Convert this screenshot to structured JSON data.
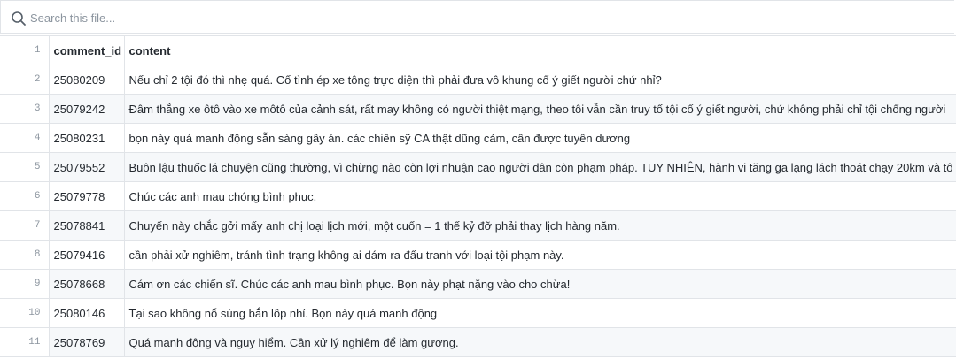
{
  "search": {
    "placeholder": "Search this file..."
  },
  "table": {
    "header_row_number": "1",
    "columns": [
      "comment_id",
      "content"
    ],
    "rows": [
      {
        "n": "2",
        "comment_id": "25080209",
        "content": "Nếu chỉ 2 tội đó thì nhẹ quá. Cố tình ép xe tông trực diện thì phải đưa vô khung cố ý giết người chứ nhỉ?"
      },
      {
        "n": "3",
        "comment_id": "25079242",
        "content": "Đâm thẳng xe ôtô vào xe môtô của cảnh sát, rất may không có người thiệt mạng, theo tôi vẫn cần truy tố tội cố ý giết người, chứ không phải chỉ tội chống người"
      },
      {
        "n": "4",
        "comment_id": "25080231",
        "content": "bọn này quá manh động sẵn sàng gây án. các chiến sỹ CA thật dũng cảm, cần được tuyên dương"
      },
      {
        "n": "5",
        "comment_id": "25079552",
        "content": "Buôn lậu thuốc lá chuyện cũng thường, vì chừng nào còn lợi nhuận cao người dân còn phạm pháp. TUY NHIÊN, hành vi tăng ga lạng lách thoát chạy 20km và tô"
      },
      {
        "n": "6",
        "comment_id": "25079778",
        "content": "Chúc các anh mau chóng bình phục."
      },
      {
        "n": "7",
        "comment_id": "25078841",
        "content": "Chuyến này chắc gởi mấy anh chị loại lịch mới, một cuốn = 1 thế kỷ đỡ phải thay lịch hàng năm."
      },
      {
        "n": "8",
        "comment_id": "25079416",
        "content": "cần phải xử nghiêm, tránh tình trạng không ai dám ra đấu tranh với loại tội phạm này."
      },
      {
        "n": "9",
        "comment_id": "25078668",
        "content": "Cám ơn các chiến sĩ. Chúc các anh mau bình phục. Bọn này phạt nặng vào cho chừa!"
      },
      {
        "n": "10",
        "comment_id": "25080146",
        "content": "Tại sao không nổ súng bắn lốp nhỉ. Bọn này quá manh động"
      },
      {
        "n": "11",
        "comment_id": "25078769",
        "content": "Quá manh động và nguy hiểm. Cần xử lý nghiêm để làm gương."
      }
    ]
  }
}
